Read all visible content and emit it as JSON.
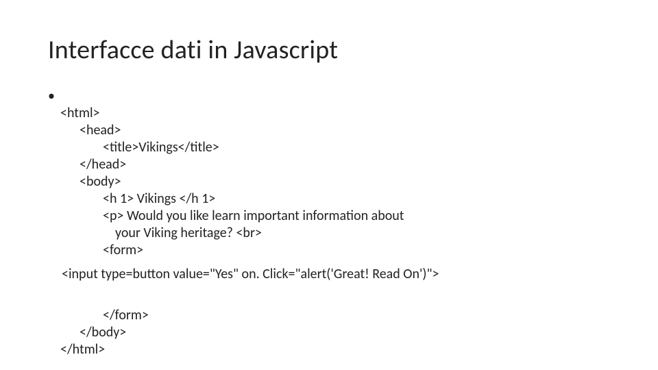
{
  "title": "Interfacce dati in Javascript",
  "bullet": "•",
  "code": {
    "l1": "<html>",
    "l2": "<head>",
    "l3": "<title>Vikings</title>",
    "l4": "</head>",
    "l5": "<body>",
    "l6": "<h 1> Vikings </h 1>",
    "l7a": "<p> Would you like learn important information about",
    "l7b": "your Viking heritage? <br>",
    "l8": "<form>",
    "input": "<input type=button value=\"Yes\" on. Click=\"alert('Great! Read On')\">",
    "l9": "</form>",
    "l10": "</body>",
    "l11": "</html>"
  }
}
